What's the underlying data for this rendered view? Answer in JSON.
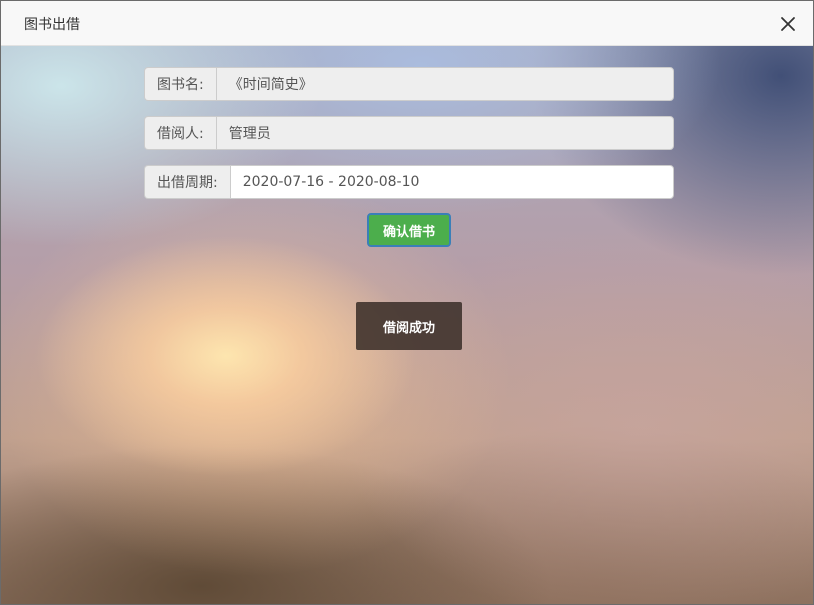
{
  "dialog": {
    "title": "图书出借"
  },
  "form": {
    "book_label": "图书名:",
    "book_value": "《时间简史》",
    "borrower_label": "借阅人:",
    "borrower_value": "管理员",
    "period_label": "出借周期:",
    "period_value": "2020-07-16 - 2020-08-10"
  },
  "actions": {
    "confirm_label": "确认借书"
  },
  "toast": {
    "message": "借阅成功"
  },
  "icons": {
    "close": "close-icon"
  },
  "colors": {
    "confirm_button": "#4cae4c",
    "toast_background": "#3c302a"
  }
}
